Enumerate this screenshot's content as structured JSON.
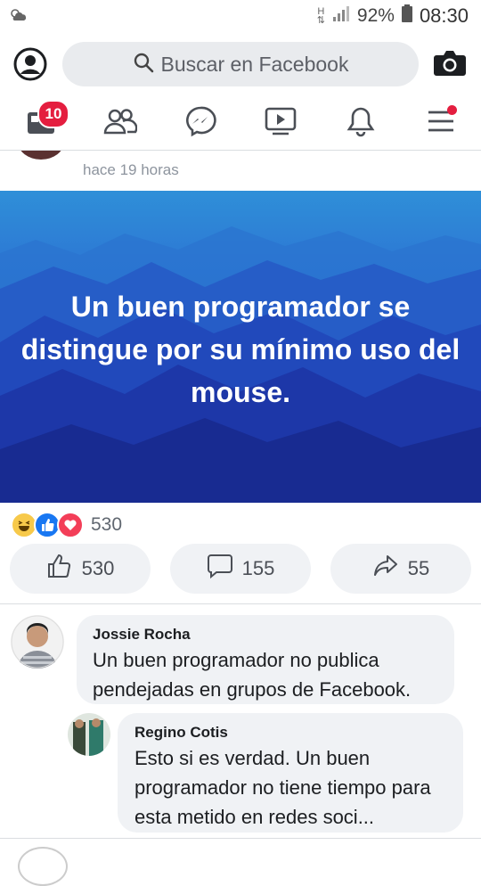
{
  "status_bar": {
    "battery": "92%",
    "time": "08:30",
    "network": "H"
  },
  "search": {
    "placeholder": "Buscar en Facebook"
  },
  "nav": {
    "home_badge": "10"
  },
  "post": {
    "time": "hace 19 horas",
    "image_text": "Un buen programador se distingue por su mínimo uso del mouse.",
    "reaction_count": "530",
    "actions": {
      "like": "530",
      "comment": "155",
      "share": "55"
    }
  },
  "comments": [
    {
      "name": "Jossie Rocha",
      "text": "Un buen programador no publica pendejadas en grupos de Facebook."
    },
    {
      "name": "Regino Cotis",
      "text": "Esto si es verdad. Un buen programador no tiene tiempo para esta metido en redes soci..."
    }
  ],
  "colors": {
    "facebook_blue": "#1877f2",
    "badge_red": "#e41e3f",
    "bubble_gray": "#f0f2f5"
  }
}
